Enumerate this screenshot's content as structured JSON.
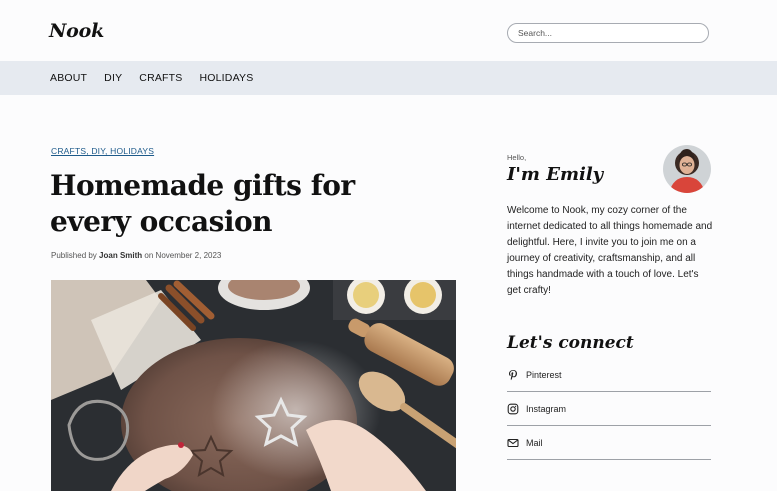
{
  "site": {
    "logo": "Nook"
  },
  "search": {
    "placeholder": "Search..."
  },
  "nav": {
    "items": [
      "ABOUT",
      "DIY",
      "CRAFTS",
      "HOLIDAYS"
    ]
  },
  "article": {
    "categories": "CRAFTS, DIY, HOLIDAYS",
    "title": "Homemade gifts for every occasion",
    "byline_prefix": "Published by",
    "author": "Joan Smith",
    "byline_on": "on",
    "date": "November 2, 2023"
  },
  "sidebar": {
    "greeting": "Hello,",
    "name": "I'm Emily",
    "bio": "Welcome to Nook, my cozy corner of the internet dedicated to all things homemade and delightful. Here, I invite you to join me on a journey of creativity, craftsmanship, and all things handmade with a touch of love. Let's get crafty!",
    "connect_title": "Let's connect",
    "social_links": [
      {
        "label": "Pinterest",
        "icon": "pinterest-icon"
      },
      {
        "label": "Instagram",
        "icon": "instagram-icon"
      },
      {
        "label": "Mail",
        "icon": "mail-icon"
      }
    ]
  },
  "colors": {
    "nav_bg": "#e6eaf0",
    "category_link": "#1d5a8a"
  }
}
